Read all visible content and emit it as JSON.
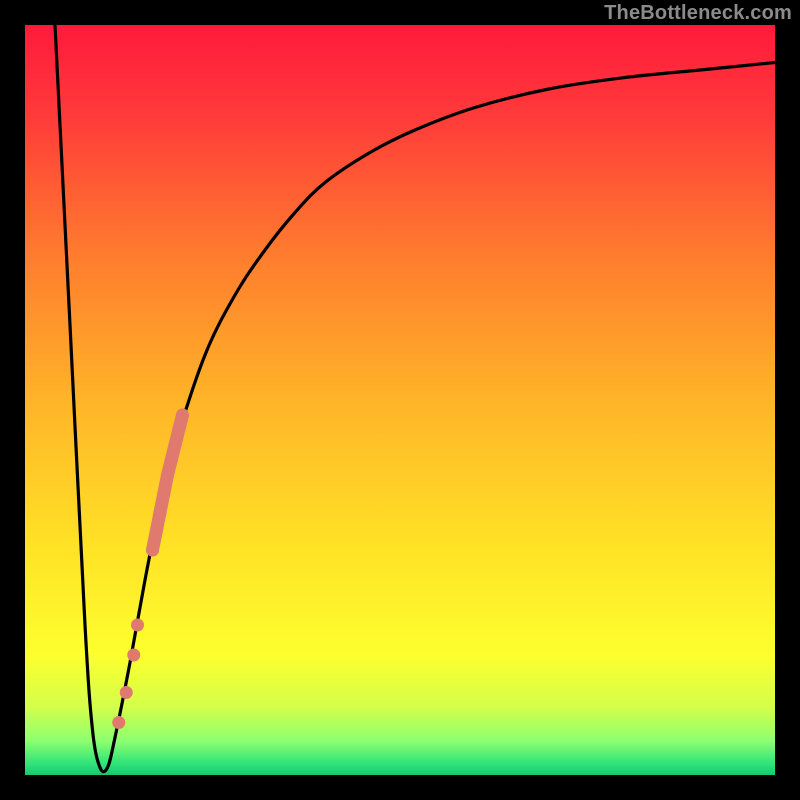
{
  "watermark": "TheBottleneck.com",
  "chart_data": {
    "type": "line",
    "title": "",
    "xlabel": "",
    "ylabel": "",
    "xlim": [
      0,
      100
    ],
    "ylim": [
      0,
      100
    ],
    "grid": false,
    "background_gradient": {
      "stops": [
        {
          "offset": 0.0,
          "color": "#ff1a3c"
        },
        {
          "offset": 0.12,
          "color": "#ff3a3a"
        },
        {
          "offset": 0.3,
          "color": "#ff7a2e"
        },
        {
          "offset": 0.5,
          "color": "#ffb428"
        },
        {
          "offset": 0.7,
          "color": "#ffe326"
        },
        {
          "offset": 0.84,
          "color": "#fdff2e"
        },
        {
          "offset": 0.91,
          "color": "#d3ff4a"
        },
        {
          "offset": 0.955,
          "color": "#8cff70"
        },
        {
          "offset": 0.985,
          "color": "#2fe37a"
        },
        {
          "offset": 1.0,
          "color": "#18c96a"
        }
      ]
    },
    "series": [
      {
        "name": "bottleneck-curve",
        "color": "#000000",
        "x": [
          4,
          6,
          8,
          9,
          10,
          11,
          12,
          14,
          16,
          18,
          20,
          24,
          28,
          32,
          36,
          40,
          46,
          52,
          60,
          70,
          80,
          90,
          100
        ],
        "y": [
          100,
          60,
          20,
          6,
          1,
          1,
          5,
          15,
          26,
          36,
          44,
          56,
          64,
          70,
          75,
          79,
          83,
          86,
          89,
          91.5,
          93,
          94,
          95
        ]
      }
    ],
    "markers": {
      "name": "highlighted-segment",
      "color": "#e07a6f",
      "points": [
        {
          "x": 12.5,
          "y": 7
        },
        {
          "x": 13.5,
          "y": 11
        },
        {
          "x": 14.5,
          "y": 16
        },
        {
          "x": 15.0,
          "y": 20
        },
        {
          "x": 17.0,
          "y": 30
        },
        {
          "x": 17.5,
          "y": 32.5
        },
        {
          "x": 18.0,
          "y": 35
        },
        {
          "x": 18.5,
          "y": 37.5
        },
        {
          "x": 19.0,
          "y": 40
        },
        {
          "x": 19.5,
          "y": 42
        },
        {
          "x": 20.0,
          "y": 44
        },
        {
          "x": 20.5,
          "y": 46
        },
        {
          "x": 21.0,
          "y": 48
        }
      ]
    }
  }
}
